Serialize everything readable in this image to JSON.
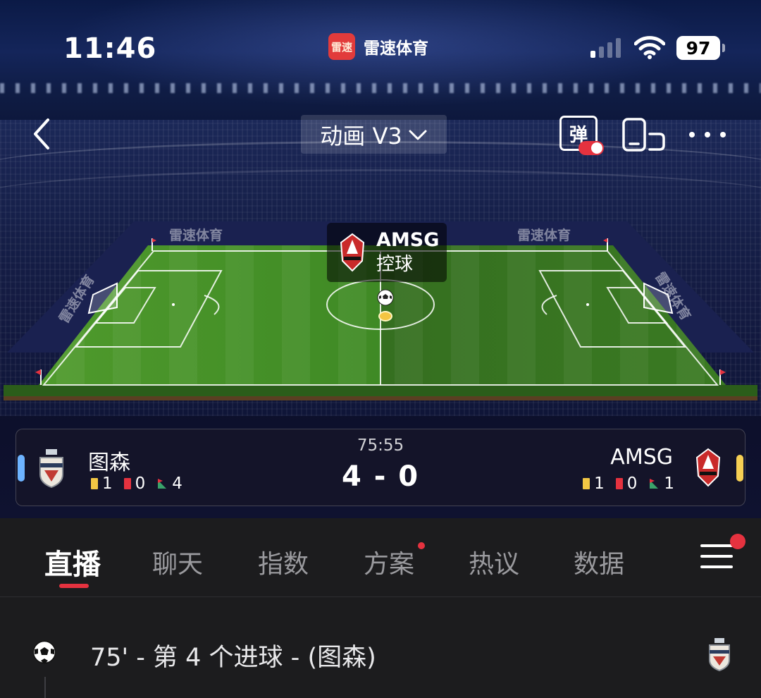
{
  "status_bar": {
    "time": "11:46",
    "app_logo_text": "雷速",
    "app_name": "雷速体育",
    "battery": "97"
  },
  "nav": {
    "mode": "动画 V3",
    "danmu_label": "弹"
  },
  "pitch": {
    "brand_watermark": "雷速体育",
    "possession_team": "AMSG",
    "possession_state": "控球"
  },
  "match": {
    "time": "75:55",
    "score": "4 - 0",
    "home": {
      "name": "图森",
      "yellow": "1",
      "red": "0",
      "corners": "4",
      "color": "#6db3ff"
    },
    "away": {
      "name": "AMSG",
      "yellow": "1",
      "red": "0",
      "corners": "1",
      "color": "#f6cf53"
    }
  },
  "tabs": [
    "直播",
    "聊天",
    "指数",
    "方案",
    "热议",
    "数据"
  ],
  "feed": {
    "event_text": "75' - 第 4 个进球 - (图森)"
  },
  "colors": {
    "accent": "#e5323f",
    "background": "#1c1c1e",
    "panel": "#141429"
  },
  "icons": {
    "back": "chevron-left-icon",
    "mode_dropdown": "chevron-down-icon",
    "screen": "phone-rotate-icon",
    "more": "more-dots-icon",
    "menu": "hamburger-icon",
    "ball": "soccer-ball-icon"
  }
}
